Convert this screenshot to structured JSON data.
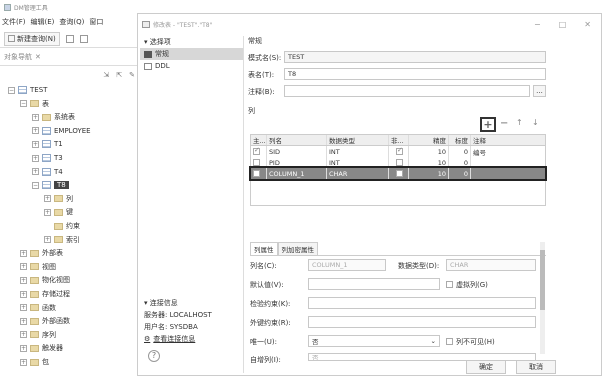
{
  "app": {
    "title": "DM管理工具"
  },
  "menu": [
    "文件(F)",
    "编辑(E)",
    "查询(Q)",
    "窗口"
  ],
  "toolbar": {
    "new_query": "新建查询(N)"
  },
  "nav": {
    "header": "对象导航",
    "tree": [
      {
        "label": "TEST",
        "kind": "db",
        "indent": 0,
        "exp": "−"
      },
      {
        "label": "表",
        "kind": "folder",
        "indent": 1,
        "exp": "−"
      },
      {
        "label": "系统表",
        "kind": "folder",
        "indent": 2,
        "exp": "+"
      },
      {
        "label": "EMPLOYEE",
        "kind": "table",
        "indent": 2,
        "exp": "+"
      },
      {
        "label": "T1",
        "kind": "table",
        "indent": 2,
        "exp": "+"
      },
      {
        "label": "T3",
        "kind": "table",
        "indent": 2,
        "exp": "+"
      },
      {
        "label": "T4",
        "kind": "table",
        "indent": 2,
        "exp": "+"
      },
      {
        "label": "T8",
        "kind": "table",
        "indent": 2,
        "exp": "−",
        "selected": true
      },
      {
        "label": "列",
        "kind": "folder",
        "indent": 3,
        "exp": "+"
      },
      {
        "label": "键",
        "kind": "folder",
        "indent": 3,
        "exp": "+"
      },
      {
        "label": "约束",
        "kind": "folder",
        "indent": 3,
        "exp": ""
      },
      {
        "label": "索引",
        "kind": "folder",
        "indent": 3,
        "exp": "+"
      },
      {
        "label": "外部表",
        "kind": "folder",
        "indent": 1,
        "exp": "+"
      },
      {
        "label": "视图",
        "kind": "folder",
        "indent": 1,
        "exp": "+"
      },
      {
        "label": "物化视图",
        "kind": "folder",
        "indent": 1,
        "exp": "+"
      },
      {
        "label": "存储过程",
        "kind": "folder",
        "indent": 1,
        "exp": "+"
      },
      {
        "label": "函数",
        "kind": "folder",
        "indent": 1,
        "exp": "+"
      },
      {
        "label": "外部函数",
        "kind": "folder",
        "indent": 1,
        "exp": "+"
      },
      {
        "label": "序列",
        "kind": "folder",
        "indent": 1,
        "exp": "+"
      },
      {
        "label": "触发器",
        "kind": "folder",
        "indent": 1,
        "exp": "+"
      },
      {
        "label": "包",
        "kind": "folder",
        "indent": 1,
        "exp": "+"
      }
    ]
  },
  "dialog": {
    "title": "修改表 - \"TEST\".\"T8\"",
    "options_header": "选择项",
    "options": [
      "常规",
      "DDL"
    ],
    "conn_header": "连接信息",
    "server": "服务器: LOCALHOST",
    "user": "用户名: SYSDBA",
    "view_conn": "查看连接信息",
    "section": "常规",
    "schema_label": "模式名(S):",
    "schema_value": "TEST",
    "table_label": "表名(T):",
    "table_value": "T8",
    "comment_label": "注释(B):",
    "comment_btn": "...",
    "columns_label": "列",
    "col_headers": [
      "主...",
      "列名",
      "数据类型",
      "非...",
      "精度",
      "标度",
      "注释"
    ],
    "rows": [
      {
        "pk": true,
        "name": "SID",
        "type": "INT",
        "nn": true,
        "prec": "10",
        "scale": "0",
        "comment": "编号"
      },
      {
        "pk": false,
        "name": "PID",
        "type": "INT",
        "nn": false,
        "prec": "10",
        "scale": "0",
        "comment": ""
      },
      {
        "pk": false,
        "name": "COLUMN_1",
        "type": "CHAR",
        "nn": false,
        "prec": "10",
        "scale": "0",
        "comment": "",
        "selected": true
      }
    ],
    "tabs": [
      "列属性",
      "列加密属性"
    ],
    "colname_label": "列名(C):",
    "colname_value": "COLUMN_1",
    "dtype_label": "数据类型(D):",
    "dtype_value": "CHAR",
    "default_label": "默认值(V):",
    "virtual_label": "虚拟列(G)",
    "check_label": "检验约束(K):",
    "fk_label": "外键约束(R):",
    "unique_label": "唯一(U):",
    "unique_value": "否",
    "invisible_label": "列不可见(H)",
    "autoinc_label": "自增列(I):",
    "autoinc_value": "否",
    "ok": "确定",
    "cancel": "取消"
  }
}
